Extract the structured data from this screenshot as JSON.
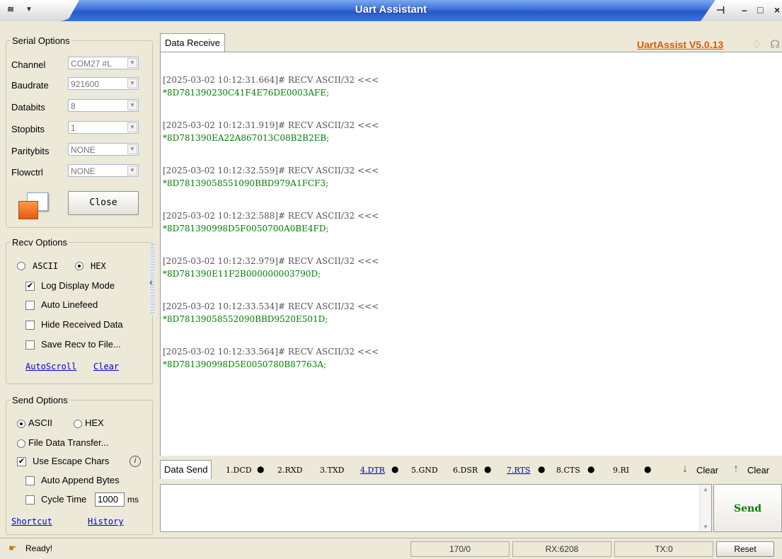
{
  "window": {
    "title": "Uart Assistant"
  },
  "version_label": "UartAssist V5.0.13",
  "serial": {
    "legend": "Serial Options",
    "channel_label": "Channel",
    "channel_value": "COM27 #L",
    "baud_label": "Baudrate",
    "baud_value": "921600",
    "databits_label": "Databits",
    "databits_value": "8",
    "stopbits_label": "Stopbits",
    "stopbits_value": "1",
    "parity_label": "Paritybits",
    "parity_value": "NONE",
    "flow_label": "Flowctrl",
    "flow_value": "NONE",
    "close_label": "Close"
  },
  "recv": {
    "legend": "Recv Options",
    "ascii_label": "ASCII",
    "hex_label": "HEX",
    "hex_selected": true,
    "log_mode_label": "Log Display Mode",
    "log_mode_checked": true,
    "auto_linefeed_label": "Auto Linefeed",
    "hide_label": "Hide Received Data",
    "save_label": "Save Recv to File...",
    "autoscroll_label": "AutoScroll",
    "clear_label": "Clear"
  },
  "send_opts": {
    "legend": "Send Options",
    "ascii_label": "ASCII",
    "hex_label": "HEX",
    "file_label": "File Data Transfer...",
    "escape_label": "Use Escape Chars",
    "append_label": "Auto Append Bytes",
    "cycle_label": "Cycle Time",
    "cycle_value": "1000",
    "cycle_unit": "ms",
    "shortcut_label": "Shortcut",
    "history_label": "History"
  },
  "receive_tab": "Data Receive",
  "log": [
    {
      "header": "[2025-03-02 10:12:31.664]# RECV ASCII/32 <<<",
      "data": "*8D781390230C41F4E76DE0003AFE;"
    },
    {
      "header": "[2025-03-02 10:12:31.919]# RECV ASCII/32 <<<",
      "data": "*8D781390EA22A867013C08B2B2EB;"
    },
    {
      "header": "[2025-03-02 10:12:32.559]# RECV ASCII/32 <<<",
      "data": "*8D78139058551090BBD979A1FCF3;"
    },
    {
      "header": "[2025-03-02 10:12:32.588]# RECV ASCII/32 <<<",
      "data": "*8D781390998D5F0050700A0BE4FD;"
    },
    {
      "header": "[2025-03-02 10:12:32.979]# RECV ASCII/32 <<<",
      "data": "*8D781390E11F2B000000003790D;"
    },
    {
      "header": "[2025-03-02 10:12:33.534]# RECV ASCII/32 <<<",
      "data": "*8D78139058552090BBD9520E501D;"
    },
    {
      "header": "[2025-03-02 10:12:33.564]# RECV ASCII/32 <<<",
      "data": "*8D781390998D5E0050780B87763A;"
    }
  ],
  "sendbar": {
    "tab": "Data Send",
    "pins": [
      "1.DCD",
      "2.RXD",
      "3.TXD",
      "4.DTR",
      "5.GND",
      "6.DSR",
      "7.RTS",
      "8.CTS",
      "9.RI"
    ],
    "clear1": "Clear",
    "clear2": "Clear",
    "send_label": "Send"
  },
  "status": {
    "ready": "Ready!",
    "counter": "170/0",
    "rx": "RX:6208",
    "tx": "TX:0",
    "reset": "Reset"
  }
}
